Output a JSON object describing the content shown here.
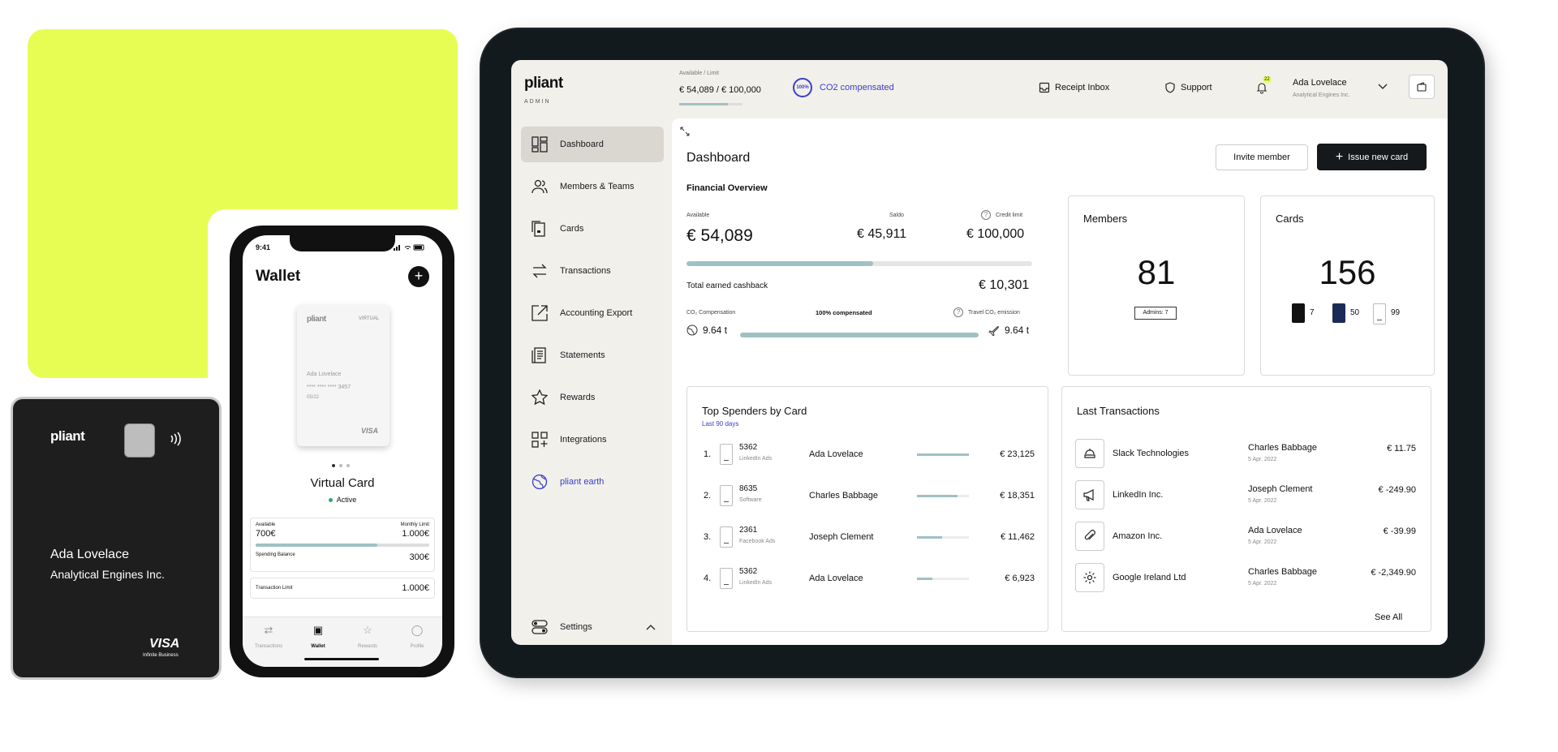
{
  "tablet": {
    "logo": "pliant",
    "logo_sub": "ADMIN",
    "header": {
      "available_label": "Available / Limit",
      "available_value": "€ 54,089 / € 100,000",
      "co2_badge": "100%",
      "co2_label": "CO2 compensated",
      "receipt_inbox": "Receipt Inbox",
      "support": "Support",
      "notifications_count": "22",
      "user_name": "Ada Lovelace",
      "user_company": "Analytical Engines Inc."
    },
    "sidebar": {
      "items": [
        {
          "label": "Dashboard",
          "icon": "dashboard-icon"
        },
        {
          "label": "Members & Teams",
          "icon": "members-icon"
        },
        {
          "label": "Cards",
          "icon": "cards-icon"
        },
        {
          "label": "Transactions",
          "icon": "transactions-icon"
        },
        {
          "label": "Accounting Export",
          "icon": "export-icon"
        },
        {
          "label": "Statements",
          "icon": "statements-icon"
        },
        {
          "label": "Rewards",
          "icon": "star-icon"
        },
        {
          "label": "Integrations",
          "icon": "integrations-icon"
        },
        {
          "label": "pliant earth",
          "icon": "globe-icon"
        }
      ],
      "settings": "Settings"
    },
    "main": {
      "title": "Dashboard",
      "invite_button": "Invite member",
      "issue_button": "Issue new card",
      "financial": {
        "title": "Financial Overview",
        "available_label": "Available",
        "available_value": "€ 54,089",
        "saldo_label": "Saldo",
        "saldo_value": "€ 45,911",
        "credit_label": "Credit limit",
        "credit_value": "€ 100,000",
        "usage_fraction": 0.54,
        "cashback_label": "Total earned cashback",
        "cashback_value": "€ 10,301",
        "co2_label": "CO₂ Compensation",
        "co2_center": "100% compensated",
        "travel_label": "Travel CO₂ emission",
        "co2_left_value": "9.64 t",
        "co2_right_value": "9.64 t",
        "co2_fraction": 1.0
      },
      "members": {
        "title": "Members",
        "count": "81",
        "admins": "Admins: 7"
      },
      "cards": {
        "title": "Cards",
        "count": "156",
        "black": "7",
        "blue": "50",
        "white": "99"
      },
      "spenders": {
        "title": "Top Spenders by Card",
        "subtitle": "Last 90 days",
        "rows": [
          {
            "rank": "1.",
            "card": "5362",
            "category": "LinkedIn Ads",
            "name": "Ada Lovelace",
            "amount": "€ 23,125",
            "fraction": 1.0
          },
          {
            "rank": "2.",
            "card": "8635",
            "category": "Software",
            "name": "Charles Babbage",
            "amount": "€ 18,351",
            "fraction": 0.78
          },
          {
            "rank": "3.",
            "card": "2361",
            "category": "Facebook Ads",
            "name": "Joseph Clement",
            "amount": "€ 11,462",
            "fraction": 0.48
          },
          {
            "rank": "4.",
            "card": "5362",
            "category": "LinkedIn Ads",
            "name": "Ada Lovelace",
            "amount": "€ 6,923",
            "fraction": 0.3
          }
        ]
      },
      "transactions": {
        "title": "Last Transactions",
        "see_all": "See All",
        "rows": [
          {
            "merchant": "Slack Technologies",
            "icon": "slack-icon",
            "person": "Charles Babbage",
            "date": "5 Apr. 2022",
            "amount": "€ 11.75"
          },
          {
            "merchant": "LinkedIn Inc.",
            "icon": "megaphone-icon",
            "person": "Joseph Clement",
            "date": "5 Apr. 2022",
            "amount": "€ -249.90"
          },
          {
            "merchant": "Amazon Inc.",
            "icon": "paperclip-icon",
            "person": "Ada Lovelace",
            "date": "5 Apr. 2022",
            "amount": "€ -39.99"
          },
          {
            "merchant": "Google Ireland Ltd",
            "icon": "gear-icon",
            "person": "Charles Babbage",
            "date": "5 Apr. 2022",
            "amount": "€ -2,349.90"
          }
        ]
      }
    }
  },
  "phone": {
    "time": "9:41",
    "title": "Wallet",
    "card_logo": "pliant",
    "card_type": "VIRTUAL",
    "card_holder": "Ada Lovelace",
    "card_number": "**** **** **** 3457",
    "card_expiry": "05/22",
    "card_network": "VISA",
    "card_title": "Virtual Card",
    "card_status": "Active",
    "available_label": "Available",
    "available_value": "700€",
    "monthly_limit_label": "Monthly Limit",
    "monthly_limit_value": "1.000€",
    "spend_fraction": 0.7,
    "spending_label": "Spending Balance",
    "spending_value": "300€",
    "transaction_limit_label": "Transaction Limit",
    "transaction_limit_value": "1.000€",
    "tabs": [
      "Transactions",
      "Wallet",
      "Rewards",
      "Profile"
    ]
  },
  "physical_card": {
    "logo": "pliant",
    "holder": "Ada Lovelace",
    "company": "Analytical Engines Inc.",
    "network": "VISA",
    "network_sub": "Infinite Business"
  },
  "colors": {
    "lime": "#e8fd54",
    "dark": "#131a1d",
    "accent_blue": "#3d3cc8",
    "teal_bar": "#9fc1c4"
  }
}
